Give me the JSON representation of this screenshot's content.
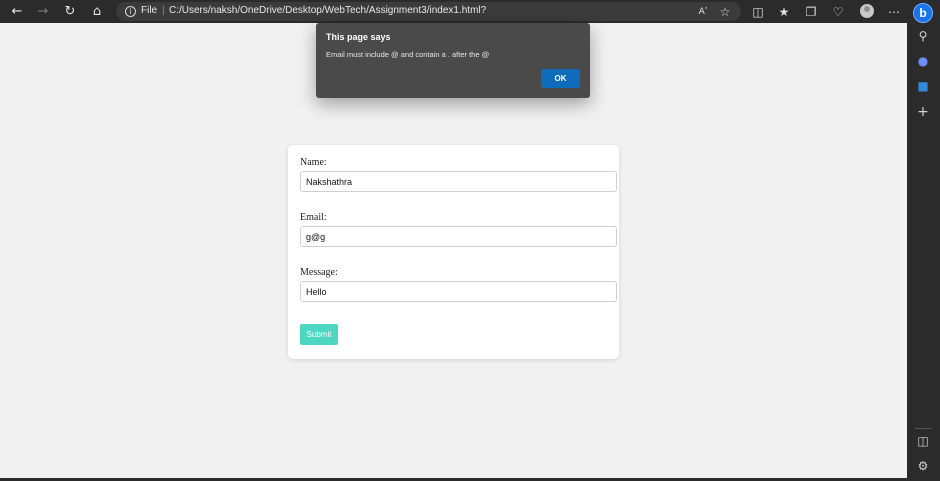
{
  "browser": {
    "file_label": "File",
    "separator": "|",
    "url": "C:/Users/naksh/OneDrive/Desktop/WebTech/Assignment3/index1.html?",
    "read_aloud_label": "Aʹ"
  },
  "dialog": {
    "title": "This page says",
    "message": "Email must include @ and contain a . after the @",
    "ok_label": "OK"
  },
  "form": {
    "name_label": "Name:",
    "name_value": "Nakshathra",
    "email_label": "Email:",
    "email_value": "g@g",
    "message_label": "Message:",
    "message_value": "Hello",
    "submit_label": "Submit"
  },
  "sidebar": {
    "bing_label": "b"
  },
  "colors": {
    "chrome_dark": "#2b2b2b",
    "page_background": "#f1f1f1",
    "dialog_background": "#4a4a4a",
    "ok_button": "#0f6cbd",
    "submit_button": "#4dd6c1"
  }
}
